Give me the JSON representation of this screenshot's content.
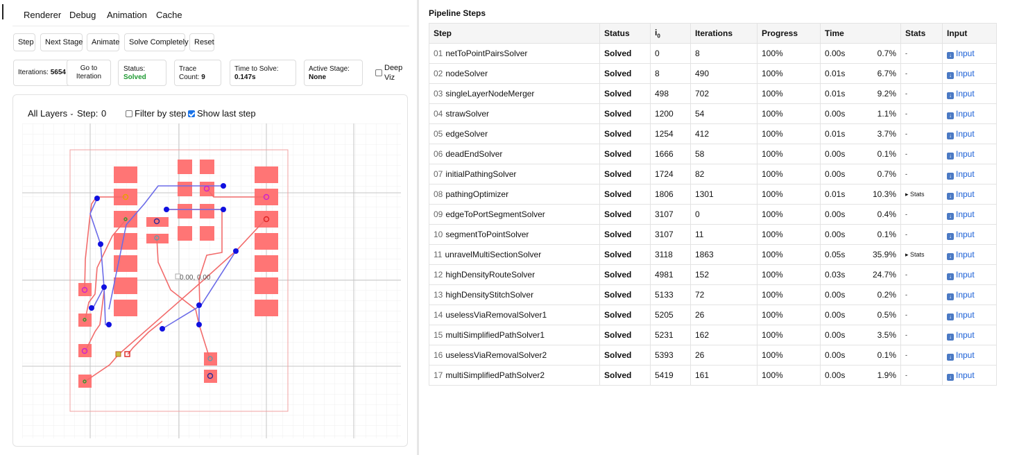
{
  "menu": [
    "Renderer",
    "Debug",
    "Animation",
    "Cache"
  ],
  "toolbar": {
    "step": "Step",
    "next_stage": "Next Stage",
    "animate": "Animate",
    "solve_completely": "Solve Completely",
    "reset": "Reset"
  },
  "info": {
    "iterations_label": "Iterations:",
    "iterations_value": "5654",
    "goto_line1": "Go to",
    "goto_line2": "Iteration",
    "status_label": "Status:",
    "status_value": "Solved",
    "trace_label": "Trace",
    "trace_count_label": "Count:",
    "trace_count_value": "9",
    "time_label": "Time to Solve:",
    "time_value": "0.147s",
    "stage_label": "Active Stage:",
    "stage_value": "None",
    "deep_viz_line1": "Deep",
    "deep_viz_line2": "Viz"
  },
  "viz": {
    "layers": "All Layers",
    "step_label": "Step:",
    "step_value": "0",
    "filter_label": "Filter by step",
    "show_last_label": "Show last step",
    "origin_label": "0.00, 0.00",
    "colors": {
      "pad": "#ff7070",
      "trace_red": "#f06a6a",
      "trace_blue": "#6a6ae8",
      "via": "#1010e0"
    }
  },
  "pipeline": {
    "title": "Pipeline Steps",
    "headers": [
      "Step",
      "Status",
      "i",
      "Iterations",
      "Progress",
      "Time",
      "Stats",
      "Input"
    ],
    "i0_subscript": "0",
    "rows": [
      {
        "num": "01",
        "name": "netToPointPairsSolver",
        "status": "Solved",
        "i0": "0",
        "iterations": "8",
        "progress": "100%",
        "time": "0.00s",
        "pct": "0.7%",
        "stats": "-",
        "input": "Input"
      },
      {
        "num": "02",
        "name": "nodeSolver",
        "status": "Solved",
        "i0": "8",
        "iterations": "490",
        "progress": "100%",
        "time": "0.01s",
        "pct": "6.7%",
        "stats": "-",
        "input": "Input"
      },
      {
        "num": "03",
        "name": "singleLayerNodeMerger",
        "status": "Solved",
        "i0": "498",
        "iterations": "702",
        "progress": "100%",
        "time": "0.01s",
        "pct": "9.2%",
        "stats": "-",
        "input": "Input"
      },
      {
        "num": "04",
        "name": "strawSolver",
        "status": "Solved",
        "i0": "1200",
        "iterations": "54",
        "progress": "100%",
        "time": "0.00s",
        "pct": "1.1%",
        "stats": "-",
        "input": "Input"
      },
      {
        "num": "05",
        "name": "edgeSolver",
        "status": "Solved",
        "i0": "1254",
        "iterations": "412",
        "progress": "100%",
        "time": "0.01s",
        "pct": "3.7%",
        "stats": "-",
        "input": "Input"
      },
      {
        "num": "06",
        "name": "deadEndSolver",
        "status": "Solved",
        "i0": "1666",
        "iterations": "58",
        "progress": "100%",
        "time": "0.00s",
        "pct": "0.1%",
        "stats": "-",
        "input": "Input"
      },
      {
        "num": "07",
        "name": "initialPathingSolver",
        "status": "Solved",
        "i0": "1724",
        "iterations": "82",
        "progress": "100%",
        "time": "0.00s",
        "pct": "0.7%",
        "stats": "-",
        "input": "Input"
      },
      {
        "num": "08",
        "name": "pathingOptimizer",
        "status": "Solved",
        "i0": "1806",
        "iterations": "1301",
        "progress": "100%",
        "time": "0.01s",
        "pct": "10.3%",
        "stats": "▸ Stats",
        "input": "Input"
      },
      {
        "num": "09",
        "name": "edgeToPortSegmentSolver",
        "status": "Solved",
        "i0": "3107",
        "iterations": "0",
        "progress": "100%",
        "time": "0.00s",
        "pct": "0.4%",
        "stats": "-",
        "input": "Input"
      },
      {
        "num": "10",
        "name": "segmentToPointSolver",
        "status": "Solved",
        "i0": "3107",
        "iterations": "11",
        "progress": "100%",
        "time": "0.00s",
        "pct": "0.1%",
        "stats": "-",
        "input": "Input"
      },
      {
        "num": "11",
        "name": "unravelMultiSectionSolver",
        "status": "Solved",
        "i0": "3118",
        "iterations": "1863",
        "progress": "100%",
        "time": "0.05s",
        "pct": "35.9%",
        "stats": "▸ Stats",
        "input": "Input"
      },
      {
        "num": "12",
        "name": "highDensityRouteSolver",
        "status": "Solved",
        "i0": "4981",
        "iterations": "152",
        "progress": "100%",
        "time": "0.03s",
        "pct": "24.7%",
        "stats": "-",
        "input": "Input"
      },
      {
        "num": "13",
        "name": "highDensityStitchSolver",
        "status": "Solved",
        "i0": "5133",
        "iterations": "72",
        "progress": "100%",
        "time": "0.00s",
        "pct": "0.2%",
        "stats": "-",
        "input": "Input"
      },
      {
        "num": "14",
        "name": "uselessViaRemovalSolver1",
        "status": "Solved",
        "i0": "5205",
        "iterations": "26",
        "progress": "100%",
        "time": "0.00s",
        "pct": "0.5%",
        "stats": "-",
        "input": "Input"
      },
      {
        "num": "15",
        "name": "multiSimplifiedPathSolver1",
        "status": "Solved",
        "i0": "5231",
        "iterations": "162",
        "progress": "100%",
        "time": "0.00s",
        "pct": "3.5%",
        "stats": "-",
        "input": "Input"
      },
      {
        "num": "16",
        "name": "uselessViaRemovalSolver2",
        "status": "Solved",
        "i0": "5393",
        "iterations": "26",
        "progress": "100%",
        "time": "0.00s",
        "pct": "0.1%",
        "stats": "-",
        "input": "Input"
      },
      {
        "num": "17",
        "name": "multiSimplifiedPathSolver2",
        "status": "Solved",
        "i0": "5419",
        "iterations": "161",
        "progress": "100%",
        "time": "0.00s",
        "pct": "1.9%",
        "stats": "-",
        "input": "Input"
      }
    ]
  }
}
